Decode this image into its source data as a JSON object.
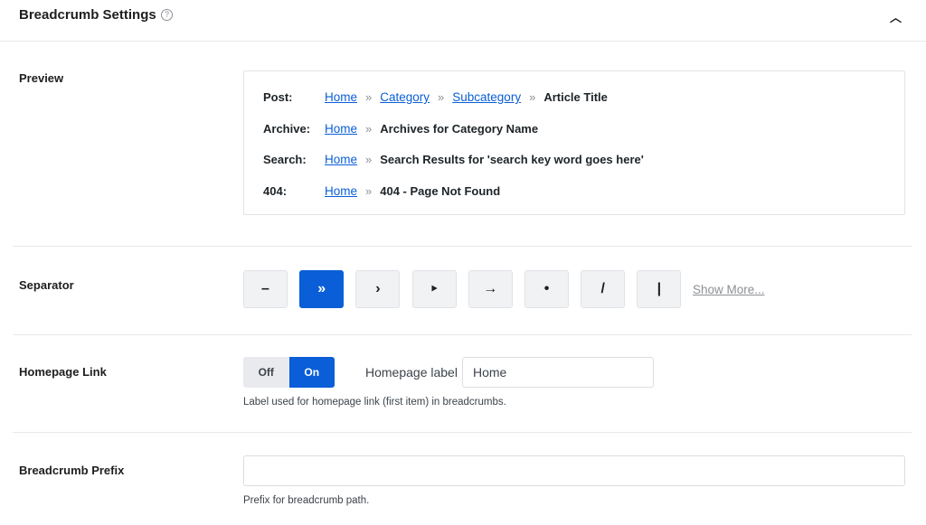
{
  "header": {
    "title": "Breadcrumb Settings",
    "help_icon": "?",
    "collapse_icon": "^"
  },
  "preview": {
    "label": "Preview",
    "rows": [
      {
        "label": "Post:",
        "links": [
          "Home",
          "Category",
          "Subcategory"
        ],
        "current": "Article Title"
      },
      {
        "label": "Archive:",
        "links": [
          "Home"
        ],
        "current": "Archives for Category Name"
      },
      {
        "label": "Search:",
        "links": [
          "Home"
        ],
        "current": "Search Results for 'search key word goes here'"
      },
      {
        "label": "404:",
        "links": [
          "Home"
        ],
        "current": "404 - Page Not Found"
      }
    ],
    "separator": "»"
  },
  "separator": {
    "label": "Separator",
    "options": [
      "–",
      "»",
      "›",
      "‣",
      "→",
      "•",
      "/",
      "|"
    ],
    "selected": 1,
    "show_more": "Show More..."
  },
  "homepage": {
    "label": "Homepage Link",
    "off": "Off",
    "on": "On",
    "state": "On",
    "field_label": "Homepage label",
    "value": "Home",
    "hint": "Label used for homepage link (first item) in breadcrumbs."
  },
  "prefix": {
    "label": "Breadcrumb Prefix",
    "value": "",
    "hint": "Prefix for breadcrumb path."
  },
  "colors": {
    "accent": "#0a5ed7"
  }
}
